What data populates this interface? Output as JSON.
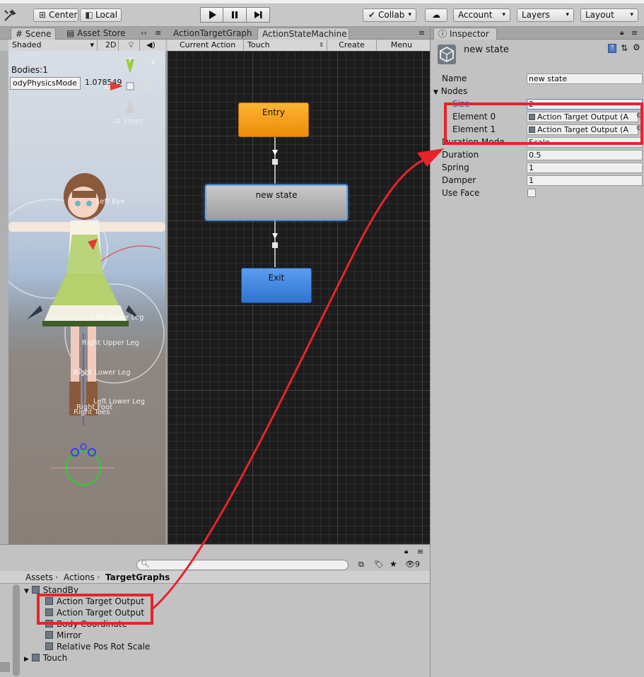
{
  "toolbar": {
    "pivot_label": "Center",
    "space_label": "Local",
    "collab_label": "Collab",
    "account_label": "Account",
    "layers_label": "Layers",
    "layout_label": "Layout"
  },
  "scene_panel": {
    "tabs": [
      "Scene",
      "Asset Store"
    ],
    "shading_mode": "Shaded",
    "mode_2d": "2D",
    "bodies_text": "Bodies:1",
    "physics_field": "odyPhysicsMode",
    "physics_value": "1.078549",
    "view_label": "Front",
    "gizmo_y": "y",
    "gizmo_x": "x",
    "bone_labels": [
      "Left Eye",
      "Left Upper Leg",
      "Right Upper Leg",
      "Right Lower Leg",
      "Left Lower Leg",
      "Right Foot",
      "Right Toes"
    ]
  },
  "graph_panel": {
    "tabs": [
      "ActionTargetGraph",
      "ActionStateMachine"
    ],
    "toolbar": [
      "Current Action",
      "Touch",
      "Create",
      "Menu"
    ],
    "nodes": {
      "entry": "Entry",
      "state": "new state",
      "exit": "Exit"
    }
  },
  "inspector": {
    "tab": "Inspector",
    "title": "new state",
    "name_label": "Name",
    "name_value": "new state",
    "nodes_label": "Nodes",
    "size_label": "Size",
    "size_value": "2",
    "elements": [
      {
        "label": "Element 0",
        "value": "Action Target Output (A"
      },
      {
        "label": "Element 1",
        "value": "Action Target Output (A"
      }
    ],
    "duration_mode_label": "Duration Mode",
    "duration_mode_value": "Scale",
    "duration_label": "Duration",
    "duration_value": "0.5",
    "spring_label": "Spring",
    "spring_value": "1",
    "damper_label": "Damper",
    "damper_value": "1",
    "use_face_label": "Use Face",
    "use_face_checked": false
  },
  "project": {
    "breadcrumb": [
      "Assets",
      "Actions",
      "TargetGraphs"
    ],
    "count": "9",
    "folder": "StandBy",
    "items": [
      "Action Target Output",
      "Action Target Output",
      "Body Coordinate",
      "Mirror",
      "Relative Pos Rot Scale"
    ],
    "collapsed_folder": "Touch"
  },
  "colors": {
    "highlight": "#e8232a",
    "entry_node": "#f39a14",
    "exit_node": "#3f86de",
    "state_node": "#b3b3b3"
  }
}
